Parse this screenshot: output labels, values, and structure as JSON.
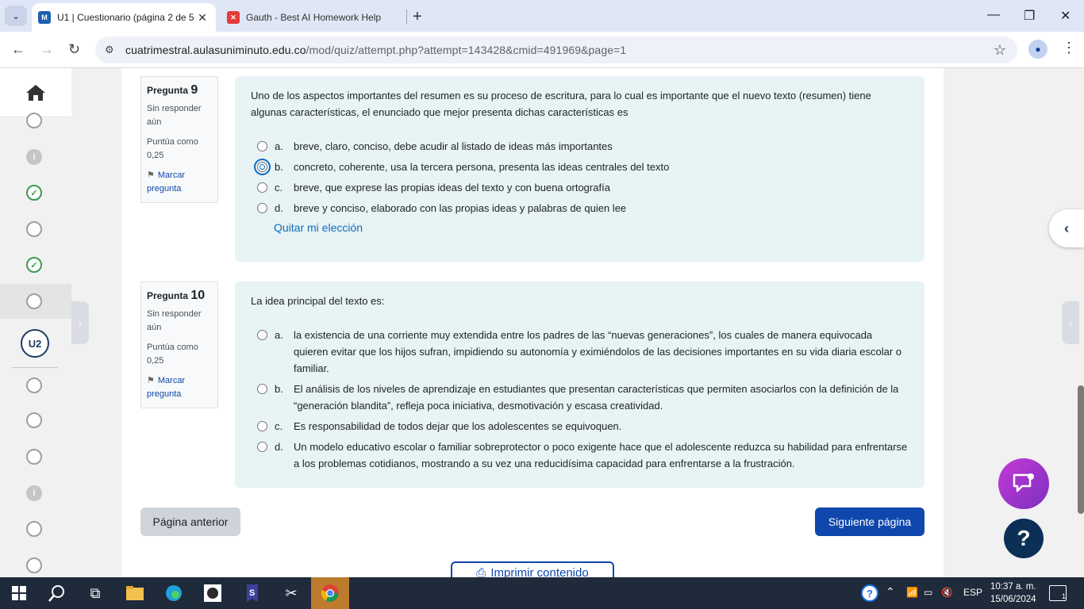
{
  "browser": {
    "tabs": [
      {
        "title": "U1 | Cuestionario (página 2 de 5",
        "favicon": "moodle-favicon"
      },
      {
        "title": "Gauth - Best AI Homework Help",
        "favicon": "gauth-favicon"
      }
    ],
    "new_tab_label": "+",
    "url_host": "cuatrimestral.aulasuniminuto.edu.co",
    "url_path": "/mod/quiz/attempt.php?attempt=143428&cmid=491969&page=1"
  },
  "drawer": {
    "unit_badge": "U2",
    "nav_states_top": [
      "empty",
      "info",
      "done",
      "empty",
      "done",
      "empty"
    ],
    "nav_states_bottom": [
      "empty",
      "empty",
      "empty",
      "info",
      "empty",
      "empty"
    ]
  },
  "questions": [
    {
      "label": "Pregunta",
      "number": "9",
      "status": "Sin responder aún",
      "grade": "Puntúa como 0,25",
      "flag": "Marcar pregunta",
      "text": "Uno de los aspectos importantes del resumen es su proceso de escritura, para lo cual es importante que el nuevo texto (resumen) tiene algunas características, el enunciado que mejor presenta dichas características es",
      "answers": [
        {
          "letter": "a.",
          "text": "breve, claro, conciso, debe acudir al listado de ideas más importantes"
        },
        {
          "letter": "b.",
          "text": "concreto, coherente, usa la tercera persona, presenta las ideas centrales del texto"
        },
        {
          "letter": "c.",
          "text": "breve, que exprese las propias ideas del texto y con buena ortografía"
        },
        {
          "letter": "d.",
          "text": "breve y conciso, elaborado con las propias ideas y palabras de quien lee"
        }
      ],
      "clear_choice": "Quitar mi elección"
    },
    {
      "label": "Pregunta",
      "number": "10",
      "status": "Sin responder aún",
      "grade": "Puntúa como 0,25",
      "flag": "Marcar pregunta",
      "text": "La idea principal del texto es:",
      "answers": [
        {
          "letter": "a.",
          "text": "la existencia de una corriente muy extendida entre los padres de las “nuevas generaciones”, los cuales de manera equivocada quieren evitar que los hijos sufran, impidiendo su autonomía y eximiéndolos de las decisiones importantes en su vida diaria escolar o familiar."
        },
        {
          "letter": "b.",
          "text": "El análisis de los niveles de aprendizaje en estudiantes que presentan características que permiten asociarlos con la definición de la “generación blandita”, refleja poca iniciativa, desmotivación y escasa creatividad."
        },
        {
          "letter": "c.",
          "text": "Es responsabilidad de todos dejar que los adolescentes se equivoquen."
        },
        {
          "letter": "d.",
          "text": "Un modelo educativo escolar o familiar sobreprotector o poco exigente hace que el adolescente reduzca su habilidad para enfrentarse a los problemas cotidianos, mostrando a su vez una reducidísima capacidad para enfrentarse a la frustración."
        }
      ]
    }
  ],
  "buttons": {
    "prev": "Página anterior",
    "next": "Siguiente página",
    "print": "Imprimir contenido"
  },
  "taskbar": {
    "language": "ESP",
    "time": "10:37 a. m.",
    "date": "15/06/2024",
    "notifications": "1"
  },
  "colors": {
    "primary": "#0f47ad",
    "question_bg": "#e7f3f5",
    "success": "#3c9b4b"
  }
}
